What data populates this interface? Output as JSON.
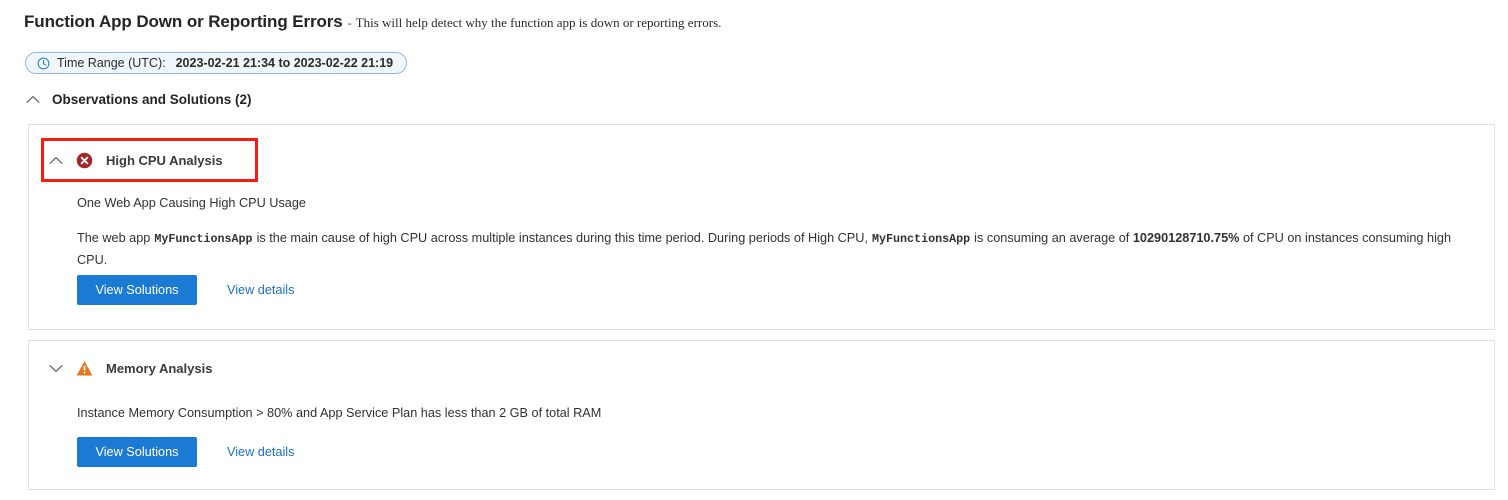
{
  "header": {
    "title": "Function App Down or Reporting Errors",
    "separator": "-",
    "subtitle": "This will help detect why the function app is down or reporting errors."
  },
  "time_range": {
    "icon": "clock-icon",
    "label": "Time Range (UTC):",
    "value": "2023-02-21 21:34 to 2023-02-22 21:19"
  },
  "section": {
    "chevron": "chevron-up-icon",
    "title": "Observations and Solutions (2)"
  },
  "cards": [
    {
      "id": "cpu",
      "chevron": "chevron-up-icon",
      "status_icon": "error-circle-icon",
      "status_color": "#a4262c",
      "title": "High CPU Analysis",
      "annotated": true,
      "annotation_color": "#fa1a10",
      "summary": "One Web App Causing High CPU Usage",
      "detail": {
        "part1": "The web app",
        "app_name_1": "MyFunctionsApp",
        "part2": "is the main cause of high CPU across multiple instances during this time period. During periods of High CPU,",
        "app_name_2": "MyFunctionsApp",
        "part3": "is consuming an average of",
        "percent": "10290128710.75%",
        "part4": "of CPU on instances consuming high CPU."
      },
      "primary_button": "View Solutions",
      "link": "View details"
    },
    {
      "id": "mem",
      "chevron": "chevron-down-icon",
      "status_icon": "warning-triangle-icon",
      "status_color": "#e8761b",
      "title": "Memory Analysis",
      "annotated": false,
      "summary": "Instance Memory Consumption > 80% and App Service Plan has less than 2 GB of total RAM",
      "primary_button": "View Solutions",
      "link": "View details"
    }
  ],
  "colors": {
    "primary_button": "#1b7ad3",
    "link": "#1b72c4",
    "pill_border": "#8ab8e8",
    "pill_background": "#eff6fc",
    "card_border": "#e1dfdd",
    "error": "#a4262c",
    "warning": "#e8761b",
    "annotation": "#fa1a10"
  }
}
